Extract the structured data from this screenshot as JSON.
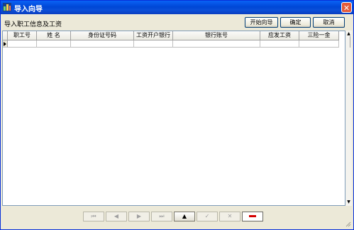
{
  "window": {
    "title": "导入向导",
    "close_glyph": "✕"
  },
  "header": {
    "label": "导入职工信息及工资"
  },
  "buttons": {
    "start": "开始向导",
    "ok": "确定",
    "cancel": "取消"
  },
  "grid": {
    "columns": [
      "职工号",
      "姓 名",
      "身份证号码",
      "工资开户银行",
      "银行账号",
      "应发工资",
      "三险一金"
    ]
  },
  "navigator": {
    "first": "⏮",
    "prior": "◀",
    "next": "▶",
    "last": "⏭",
    "insert": "▲",
    "post": "✓",
    "cancel": "✕"
  },
  "colors": {
    "titlebar": "#0a4fd8",
    "close": "#e55b3b",
    "delete_bar": "#d40000",
    "face": "#ece9d8"
  }
}
